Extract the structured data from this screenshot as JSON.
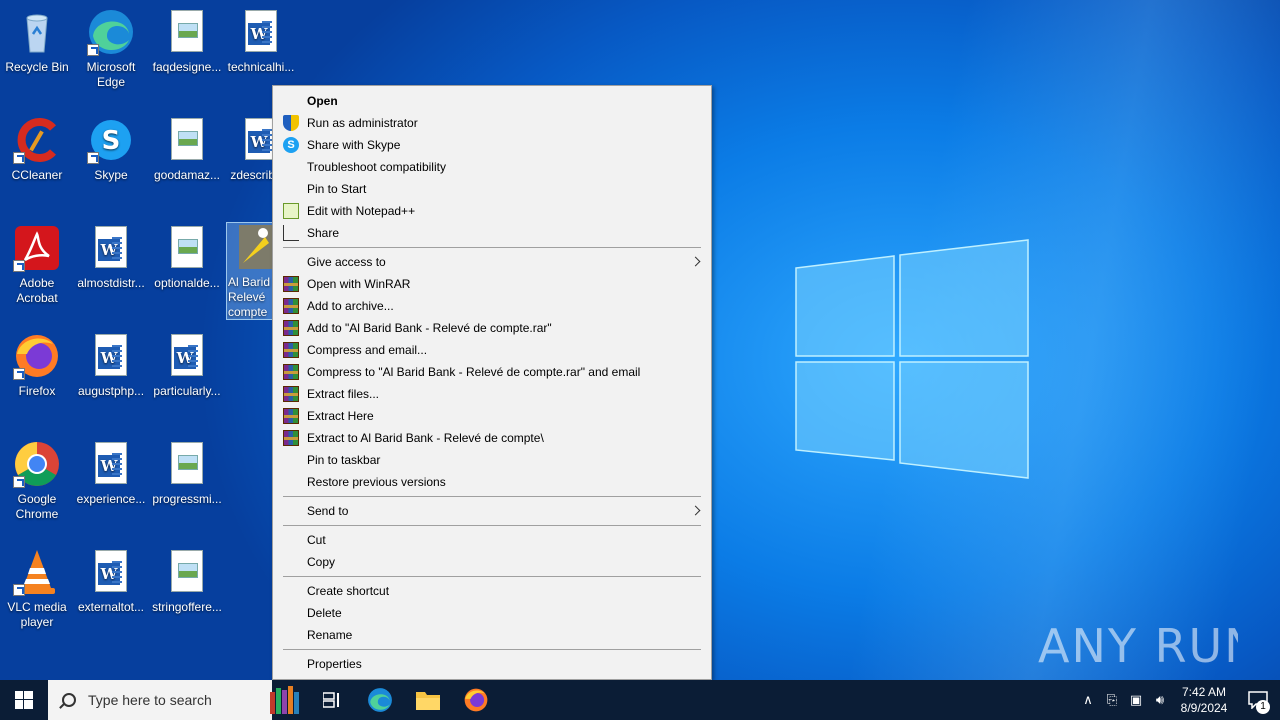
{
  "desktop": {
    "icons": [
      {
        "label": "Recycle Bin"
      },
      {
        "label": "Microsoft Edge"
      },
      {
        "label": "faqdesigne..."
      },
      {
        "label": "technicalhi..."
      },
      {
        "label": "CCleaner"
      },
      {
        "label": "Skype"
      },
      {
        "label": "goodamaz..."
      },
      {
        "label": "zdescribe..."
      },
      {
        "label": "Adobe Acrobat"
      },
      {
        "label": "almostdistr..."
      },
      {
        "label": "optionalde..."
      },
      {
        "label": "Al Barid - Relevé compte"
      },
      {
        "label": "Firefox"
      },
      {
        "label": "augustphp..."
      },
      {
        "label": "particularly..."
      },
      {
        "label": "Google Chrome"
      },
      {
        "label": "experience..."
      },
      {
        "label": "progressmi..."
      },
      {
        "label": "VLC media player"
      },
      {
        "label": "externaltot..."
      },
      {
        "label": "stringoffere..."
      }
    ],
    "watermark": "ANY RUN"
  },
  "context_menu": {
    "items": [
      {
        "label": "Open",
        "icon": ""
      },
      {
        "label": "Run as administrator",
        "icon": "shield-icon"
      },
      {
        "label": "Share with Skype",
        "icon": "skype-icon"
      },
      {
        "label": "Troubleshoot compatibility",
        "icon": ""
      },
      {
        "label": "Pin to Start",
        "icon": ""
      },
      {
        "label": "Edit with Notepad++",
        "icon": "notepadpp-icon"
      },
      {
        "label": "Share",
        "icon": "share-icon"
      },
      {
        "label": "Give access to",
        "icon": ""
      },
      {
        "label": "Open with WinRAR",
        "icon": "winrar-icon"
      },
      {
        "label": "Add to archive...",
        "icon": "winrar-icon"
      },
      {
        "label": "Add to \"Al Barid Bank - Relevé de compte.rar\"",
        "icon": "winrar-icon"
      },
      {
        "label": "Compress and email...",
        "icon": "winrar-icon"
      },
      {
        "label": "Compress to \"Al Barid Bank - Relevé de compte.rar\" and email",
        "icon": "winrar-icon"
      },
      {
        "label": "Extract files...",
        "icon": "winrar-icon"
      },
      {
        "label": "Extract Here",
        "icon": "winrar-icon"
      },
      {
        "label": "Extract to Al Barid Bank - Relevé de compte\\",
        "icon": "winrar-icon"
      },
      {
        "label": "Pin to taskbar",
        "icon": ""
      },
      {
        "label": "Restore previous versions",
        "icon": ""
      },
      {
        "label": "Send to",
        "icon": ""
      },
      {
        "label": "Cut",
        "icon": ""
      },
      {
        "label": "Copy",
        "icon": ""
      },
      {
        "label": "Create shortcut",
        "icon": ""
      },
      {
        "label": "Delete",
        "icon": ""
      },
      {
        "label": "Rename",
        "icon": ""
      },
      {
        "label": "Properties",
        "icon": ""
      }
    ]
  },
  "taskbar": {
    "search_placeholder": "Type here to search",
    "time": "7:42 AM",
    "date": "8/9/2024",
    "notification_count": "1"
  },
  "colors": {
    "taskbar": "#0b1d36",
    "menu_bg": "#f2f2f2",
    "wallpaper": "#0b7ce6"
  }
}
